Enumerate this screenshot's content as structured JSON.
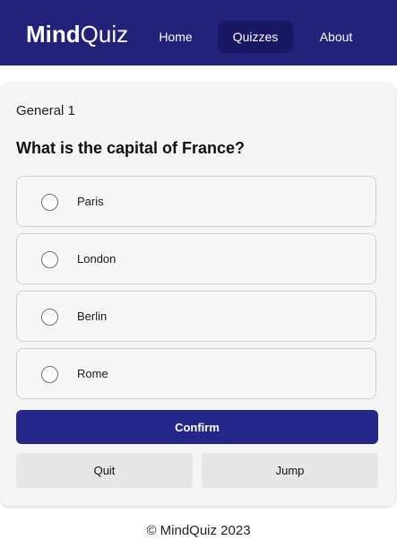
{
  "navbar": {
    "logo_bold": "Mind",
    "logo_light": "Quiz",
    "items": [
      {
        "label": "Home",
        "active": false
      },
      {
        "label": "Quizzes",
        "active": true
      },
      {
        "label": "About",
        "active": false
      }
    ],
    "background_color": "#22227a",
    "active_item_color": "#171763"
  },
  "quiz": {
    "category": "General 1",
    "question": "What is the capital of France?",
    "options": [
      {
        "label": "Paris",
        "selected": false
      },
      {
        "label": "London",
        "selected": false
      },
      {
        "label": "Berlin",
        "selected": false
      },
      {
        "label": "Rome",
        "selected": false
      }
    ],
    "confirm_label": "Confirm",
    "quit_label": "Quit",
    "jump_label": "Jump",
    "confirm_color": "#24268a"
  },
  "footer": {
    "text": "© MindQuiz 2023"
  }
}
